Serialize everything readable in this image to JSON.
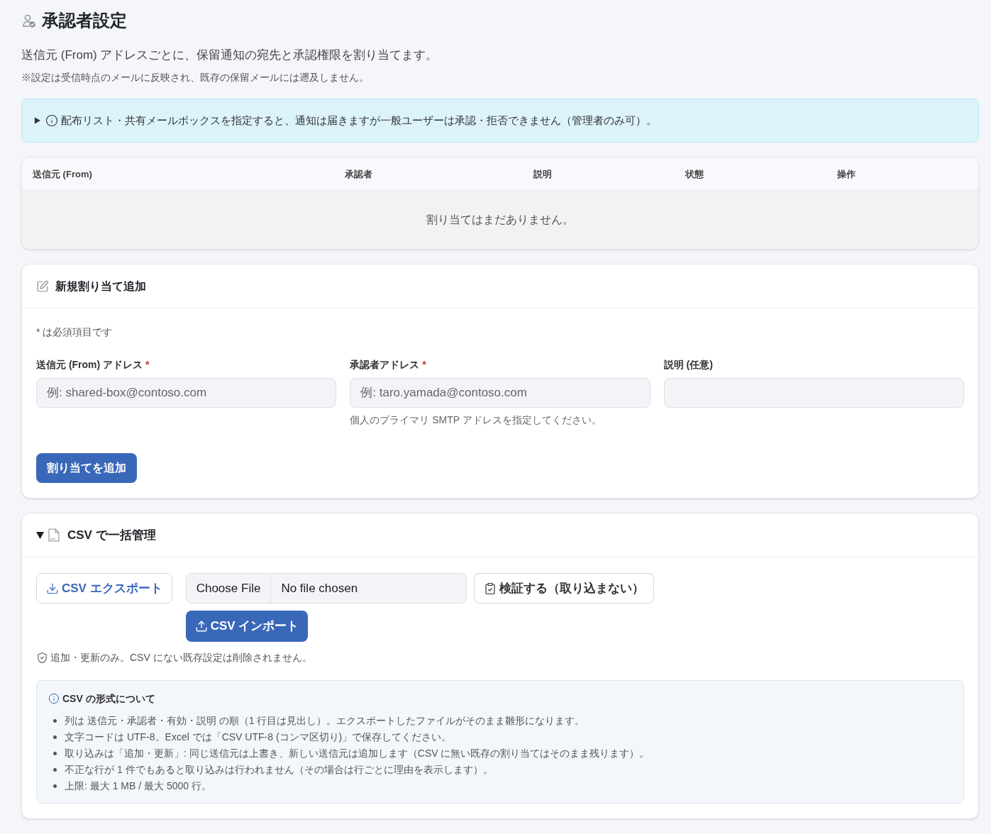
{
  "page": {
    "title": "承認者設定",
    "description": "送信元 (From) アドレスごとに、保留通知の宛先と承認権限を割り当てます。",
    "note": "※設定は受信時点のメールに反映され、既存の保留メールには遡及しません。"
  },
  "alert": {
    "expanded": false,
    "text": "配布リスト・共有メールボックスを指定すると、通知は届きますが一般ユーザーは承認・拒否できません（管理者のみ可）。"
  },
  "table": {
    "columns": [
      "送信元 (From)",
      "承認者",
      "説明",
      "状態",
      "操作"
    ],
    "empty_message": "割り当てはまだありません。"
  },
  "new_assignment": {
    "title": "新規割り当て追加",
    "required_note": "* は必須項目です",
    "fields": [
      {
        "label": "送信元 (From) アドレス",
        "required_mark": "*",
        "placeholder": "例: shared-box@contoso.com"
      },
      {
        "label": "承認者アドレス",
        "required_mark": "*",
        "placeholder": "例: taro.yamada@contoso.com",
        "hint": "個人のプライマリ SMTP アドレスを指定してください。"
      },
      {
        "label": "説明 (任意)"
      }
    ],
    "submit_button": "割り当てを追加"
  },
  "csv": {
    "expanded": true,
    "title": "CSV で一括管理",
    "export_button": "CSV エクスポート",
    "file_input": {
      "button": "Choose File",
      "status": "No file chosen"
    },
    "validate_button": "検証する（取り込まない）",
    "import_button": "CSV インポート",
    "note": "追加・更新のみ。CSV にない既存設定は削除されません。",
    "format": {
      "title": "CSV の形式について",
      "items": [
        "列は 送信元・承認者・有効・説明 の順（1 行目は見出し）。エクスポートしたファイルがそのまま雛形になります。",
        "文字コードは UTF-8。Excel では「CSV UTF-8 (コンマ区切り)」で保存してください。",
        "取り込みは「追加・更新」: 同じ送信元は上書き、新しい送信元は追加します（CSV に無い既存の割り当てはそのまま残ります）。",
        "不正な行が 1 件でもあると取り込みは行われません（その場合は行ごとに理由を表示します）。",
        "上限: 最大 1 MB / 最大 5000 行。"
      ]
    }
  }
}
